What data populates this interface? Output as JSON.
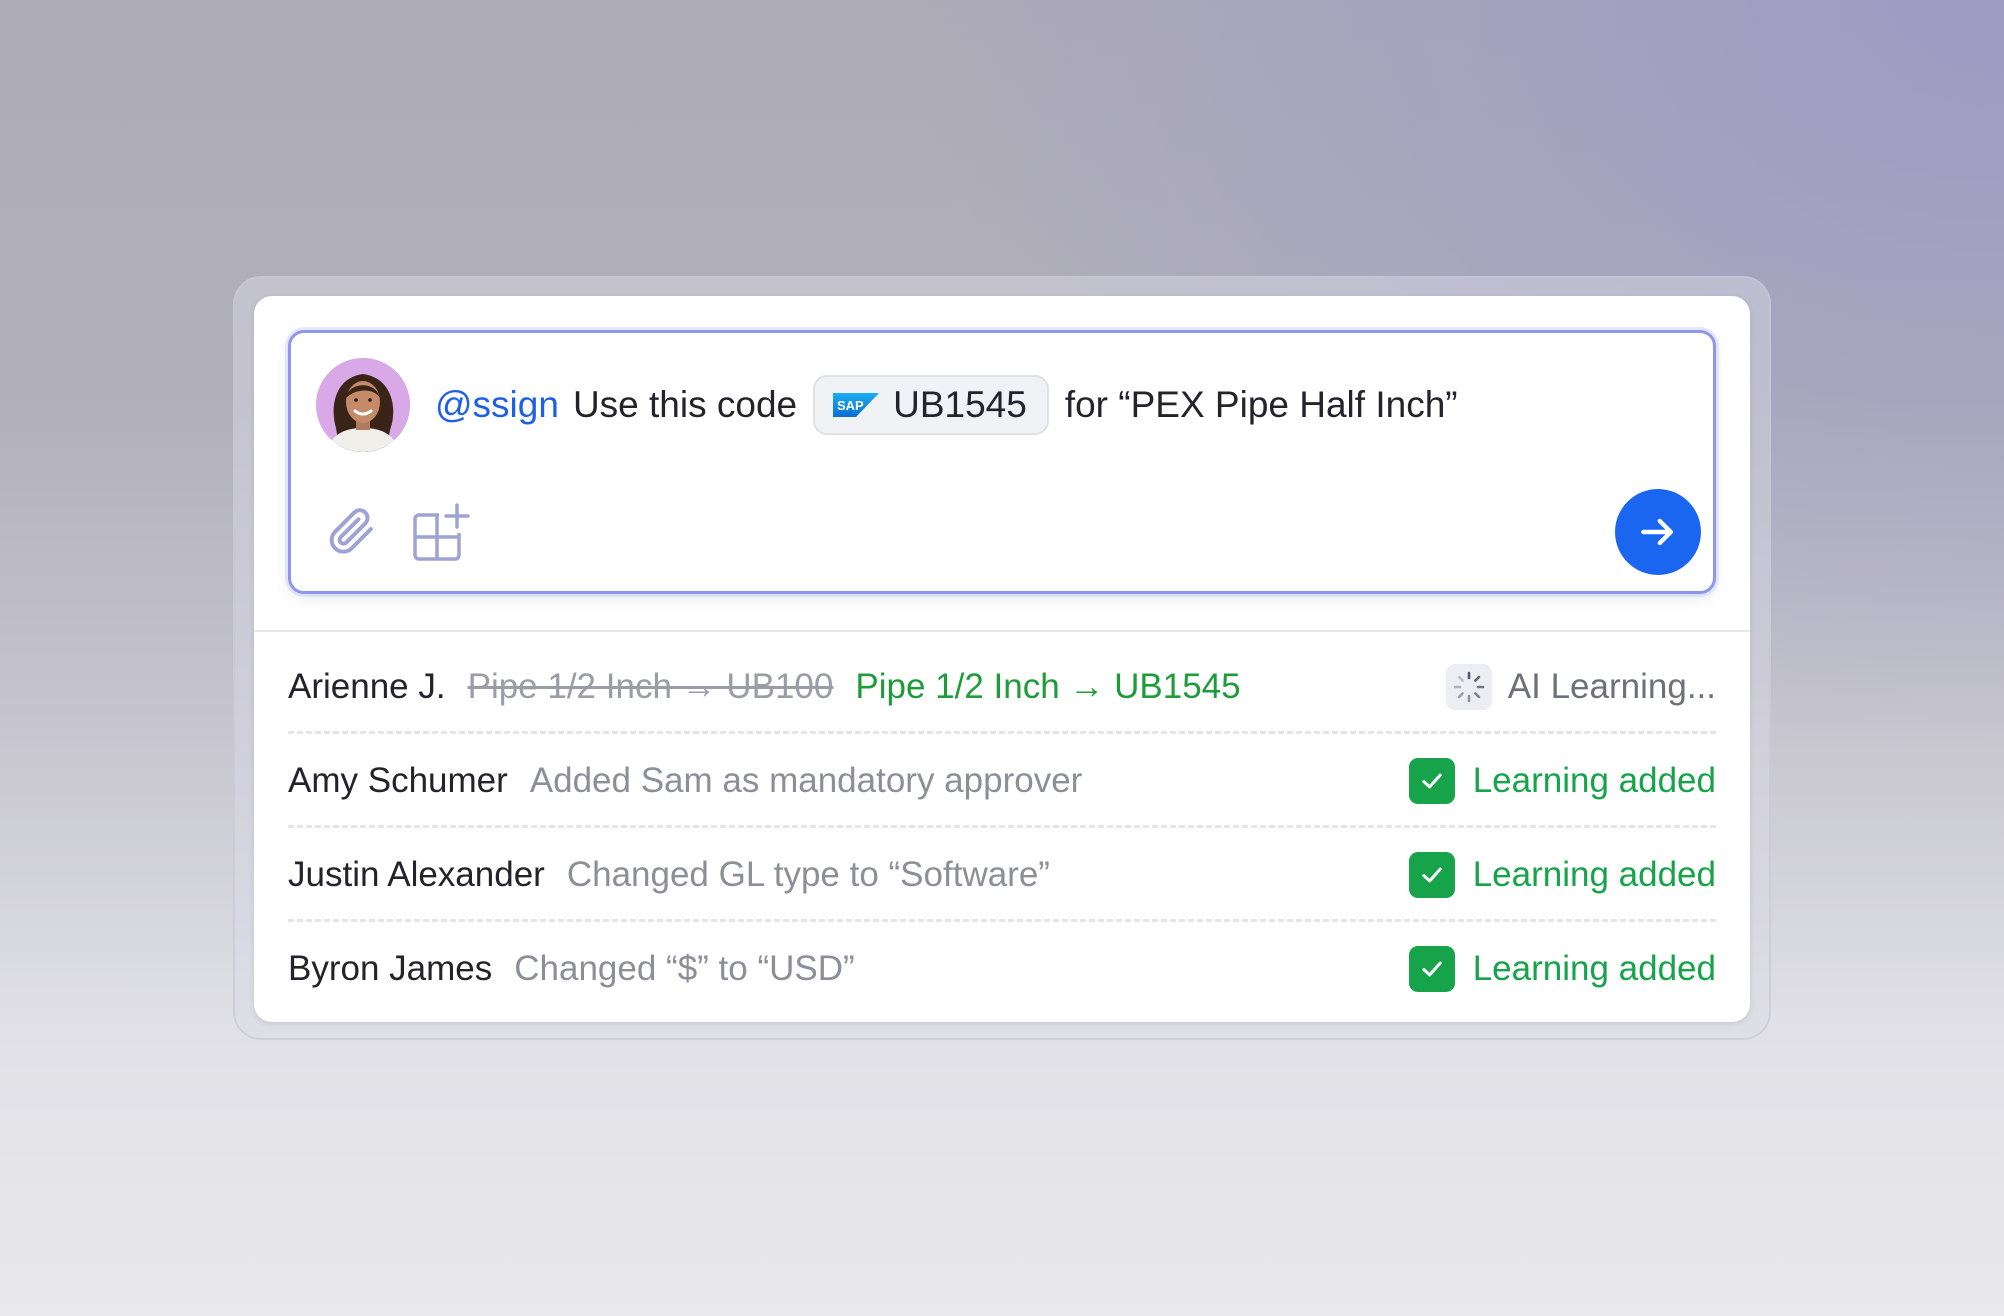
{
  "composer": {
    "mention": "@ssign",
    "text_before_chip": "Use this code",
    "chip": {
      "logo": "SAP",
      "code": "UB1545"
    },
    "text_after_chip": "for “PEX Pipe Half Inch”",
    "icons": [
      "paperclip-icon",
      "add-widget-icon",
      "arrow-right-icon"
    ],
    "send_color": "#1a66f0"
  },
  "activity": [
    {
      "name": "Arienne J.",
      "old_mapping": "Pipe 1/2 Inch → UB100",
      "new_mapping": "Pipe 1/2 Inch → UB1545",
      "status": "AI Learning...",
      "status_icon": "spinner-icon"
    },
    {
      "name": "Amy Schumer",
      "description": "Added Sam as mandatory approver",
      "status": "Learning added",
      "status_icon": "check-icon"
    },
    {
      "name": "Justin Alexander",
      "description": "Changed GL type to “Software”",
      "status": "Learning added",
      "status_icon": "check-icon"
    },
    {
      "name": "Byron James",
      "description": "Changed “$” to “USD”",
      "status": "Learning added",
      "status_icon": "check-icon"
    }
  ],
  "colors": {
    "accent_blue": "#1f5fe6",
    "success_green": "#16a34a",
    "composer_border": "#8f96ee"
  }
}
